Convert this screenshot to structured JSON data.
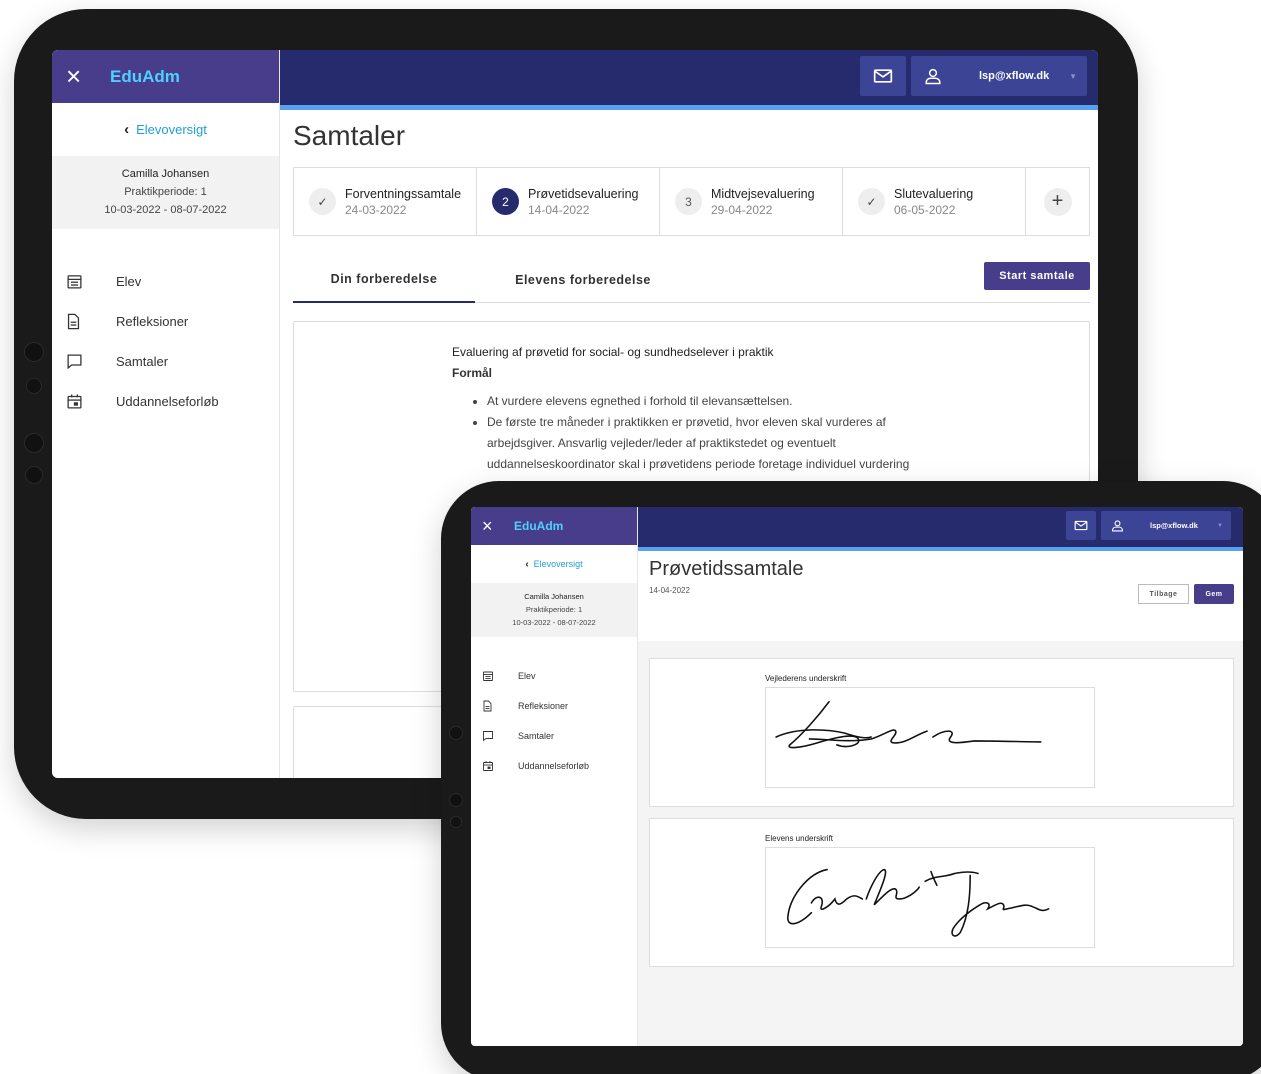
{
  "app": {
    "brand": "EduAdm",
    "close_icon": "×",
    "user_email": "lsp@xflow.dk"
  },
  "sidebar": {
    "back_link": "Elevoversigt",
    "student": {
      "name": "Camilla Johansen",
      "period": "Praktikperiode: 1",
      "dates": "10-03-2022 - 08-07-2022"
    },
    "items": [
      {
        "label": "Elev",
        "icon": "calendar-list-icon"
      },
      {
        "label": "Refleksioner",
        "icon": "document-icon"
      },
      {
        "label": "Samtaler",
        "icon": "chat-bubble-icon"
      },
      {
        "label": "Uddannelseforløb",
        "icon": "calendar-icon"
      }
    ]
  },
  "back_screen": {
    "title": "Samtaler",
    "steps": [
      {
        "badge": "✓",
        "status": "done",
        "title": "Forventningssamtale",
        "date": "24-03-2022"
      },
      {
        "badge": "2",
        "status": "active",
        "title": "Prøvetidsevaluering",
        "date": "14-04-2022"
      },
      {
        "badge": "3",
        "status": "todo",
        "title": "Midtvejsevaluering",
        "date": "29-04-2022"
      },
      {
        "badge": "✓",
        "status": "done",
        "title": "Slutevaluering",
        "date": "06-05-2022"
      }
    ],
    "add_step_icon": "+",
    "tabs": [
      {
        "label": "Din forberedelse",
        "active": true
      },
      {
        "label": "Elevens forberedelse",
        "active": false
      }
    ],
    "start_button": "Start samtale",
    "card": {
      "heading": "Evaluering af prøvetid for social- og sundhedselever i praktik",
      "subheading": "Formål",
      "bullets": [
        "At vurdere elevens egnethed i forhold til elevansættelsen.",
        "De første tre måneder i praktikken er prøvetid, hvor eleven skal vurderes af arbejdsgiver. Ansvarlig vejleder/leder af praktikstedet og eventuelt uddannelseskoordinator skal i prøvetidens periode foretage individuel vurdering"
      ]
    }
  },
  "front_screen": {
    "title": "Prøvetidssamtale",
    "date": "14-04-2022",
    "back_button": "Tilbage",
    "save_button": "Gem",
    "signatures": [
      {
        "label": "Vejlederens underskrift"
      },
      {
        "label": "Elevens underskrift"
      }
    ]
  },
  "colors": {
    "brand_purple": "#483d8b",
    "topbar_navy": "#262b6e",
    "accent_cyan": "#4fd0ff",
    "link_blue": "#21a0d6"
  }
}
